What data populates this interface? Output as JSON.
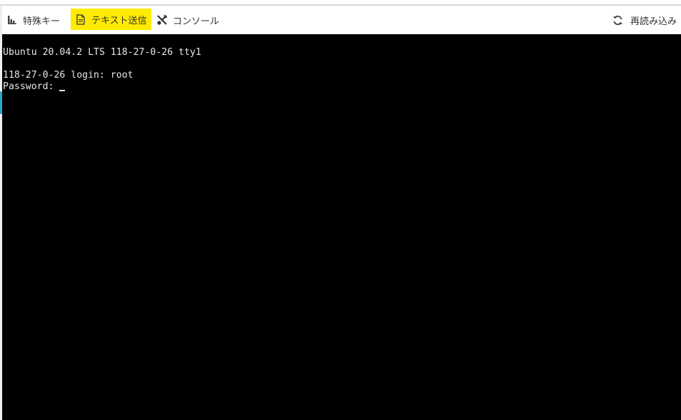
{
  "toolbar": {
    "special_keys": {
      "label": "特殊キー",
      "icon": "bar-chart-icon"
    },
    "send_text": {
      "label": "テキスト送信",
      "icon": "document-icon",
      "highlight": "#ffeb00"
    },
    "console": {
      "label": "コンソール",
      "icon": "tools-icon"
    },
    "reload": {
      "label": "再読み込み",
      "icon": "refresh-icon"
    }
  },
  "terminal": {
    "banner": "Ubuntu 20.04.2 LTS 118-27-0-26 tty1",
    "login_line": "118-27-0-26 login: root",
    "password_prompt": "Password:"
  },
  "colors": {
    "terminal_bg": "#000000",
    "terminal_fg": "#e6e6e6",
    "accent": "#2aa9c9"
  }
}
